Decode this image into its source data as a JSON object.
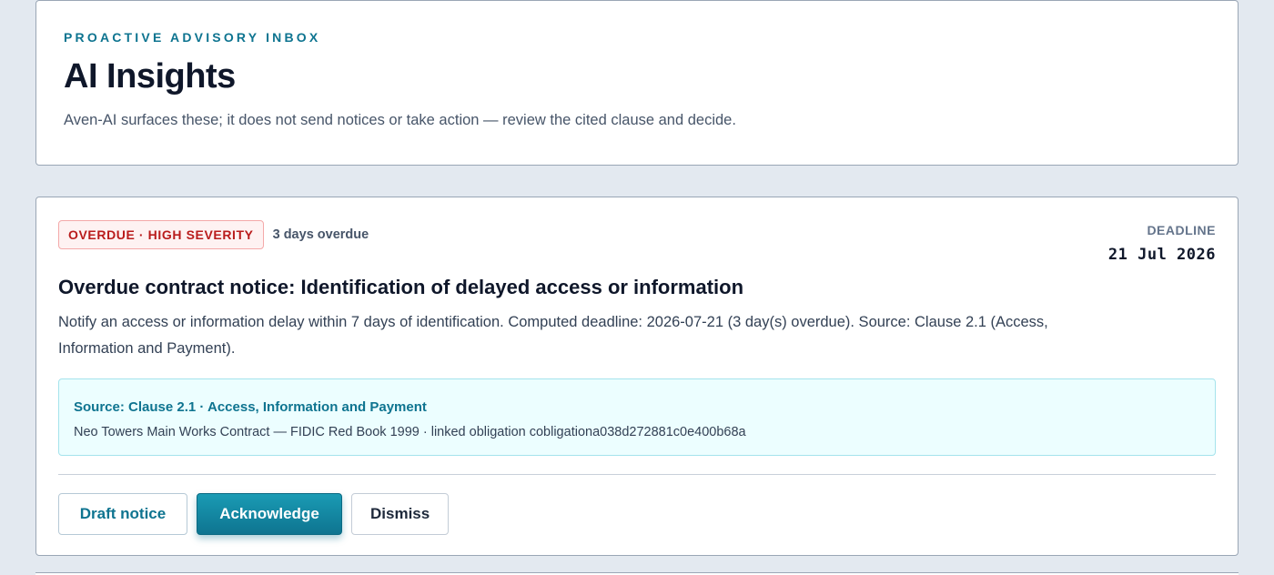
{
  "header": {
    "eyebrow": "PROACTIVE ADVISORY INBOX",
    "title": "AI Insights",
    "subtitle": "Aven-AI surfaces these; it does not send notices or take action — review the cited clause and decide."
  },
  "insight": {
    "severity_badge": "OVERDUE · HIGH SEVERITY",
    "overdue_text": "3 days overdue",
    "deadline_label": "DEADLINE",
    "deadline_value": "21 Jul 2026",
    "title": "Overdue contract notice: Identification of delayed access or information",
    "description": "Notify an access or information delay within 7 days of identification. Computed deadline: 2026-07-21 (3 day(s) overdue). Source: Clause 2.1 (Access, Information and Payment).",
    "source_title": "Source: Clause 2.1 · Access, Information and Payment",
    "source_detail": "Neo Towers Main Works Contract — FIDIC Red Book 1999 · linked obligation cobligationa038d272881c0e400b68a",
    "actions": {
      "draft_label": "Draft notice",
      "acknowledge_label": "Acknowledge",
      "dismiss_label": "Dismiss"
    }
  },
  "colors": {
    "accent": "#0e7490",
    "danger": "#b91c1c",
    "background": "#e3e9f0",
    "source_bg": "#ecfeff"
  }
}
